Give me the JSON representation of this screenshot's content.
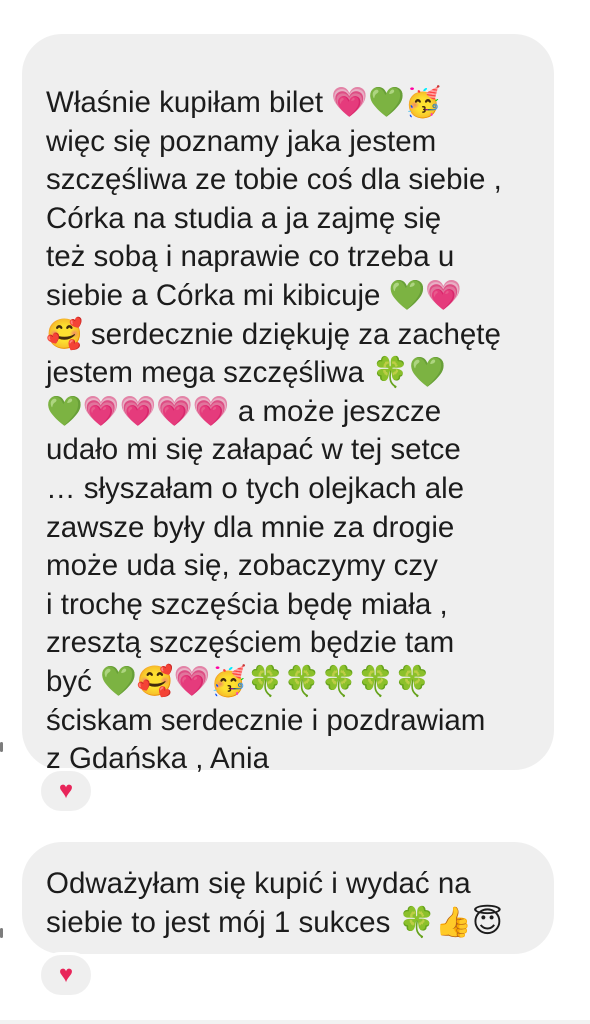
{
  "messages": [
    {
      "lines": [
        "Właśnie kupiłam bilet 💗💚🥳",
        "więc się poznamy jaka jestem",
        "szczęśliwa ze tobie coś dla siebie ,",
        "Córka na studia a ja zajmę się",
        "też sobą i naprawie co trzeba u",
        "siebie a Córka mi kibicuje 💚💗",
        "🥰 serdecznie dziękuję za zachętę",
        "jestem mega szczęśliwa 🍀💚",
        "💚💗💗💗💗 a może jeszcze",
        "udało mi się załapać w tej setce",
        "… słyszałam o tych olejkach ale",
        "zawsze były dla mnie za drogie",
        "może uda się, zobaczymy czy",
        "i trochę szczęścia będę miała ,",
        " zresztą szczęściem będzie tam",
        "być 💚🥰💗🥳🍀🍀🍀🍀🍀",
        "ściskam serdecznie i pozdrawiam",
        "z Gdańska , Ania"
      ],
      "reaction": "♥"
    },
    {
      "lines": [
        "Odważyłam się kupić i wydać na",
        "siebie to jest mój 1 sukces 🍀👍😇"
      ],
      "reaction": "♥"
    }
  ],
  "colors": {
    "bubble_bg": "#efefef",
    "text": "#1c1c1c",
    "reaction_heart": "#e8255a"
  }
}
